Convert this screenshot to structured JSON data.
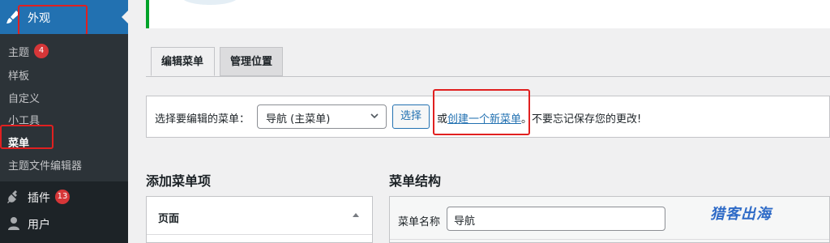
{
  "sidebar": {
    "appearance": {
      "label": "外观",
      "icon": "paintbrush-icon"
    },
    "submenu": [
      {
        "label": "主题",
        "badge": "4"
      },
      {
        "label": "样板"
      },
      {
        "label": "自定义"
      },
      {
        "label": "小工具"
      },
      {
        "label": "菜单",
        "current": true
      },
      {
        "label": "主题文件编辑器"
      }
    ],
    "plugins": {
      "label": "插件",
      "badge": "13",
      "icon": "plug-icon"
    },
    "users": {
      "label": "用户",
      "icon": "user-icon"
    }
  },
  "main": {
    "tabs": [
      {
        "label": "编辑菜单",
        "active": true
      },
      {
        "label": "管理位置",
        "active": false
      }
    ],
    "select_menu": {
      "label": "选择要编辑的菜单：",
      "selected": "导航 (主菜单)",
      "button": "选择",
      "or_text": "或",
      "create_link": "创建一个新菜单",
      "suffix": "。不要忘记保存您的更改!"
    },
    "add_items": {
      "title": "添加菜单项",
      "accordion_pages": "页面"
    },
    "structure": {
      "title": "菜单结构",
      "name_label": "菜单名称",
      "name_value": "导航"
    }
  },
  "watermark": "猎客出海",
  "colors": {
    "accent": "#2271b1",
    "sidebar": "#1d2327",
    "highlight": "#e02020",
    "badge": "#d63638"
  }
}
